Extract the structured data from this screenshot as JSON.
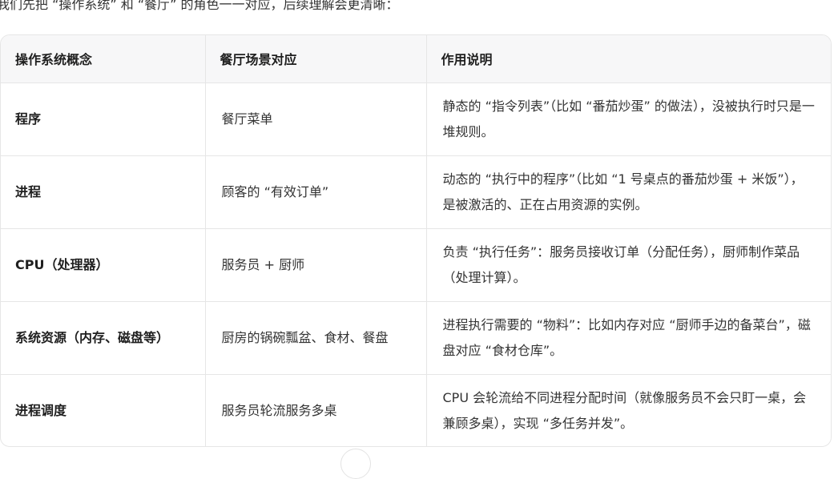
{
  "intro": "我们先把 “操作系统” 和 “餐厅” 的角色一一对应，后续理解会更清晰：",
  "table": {
    "headers": [
      "操作系统概念",
      "餐厅场景对应",
      "作用说明"
    ],
    "rows": [
      {
        "concept": "程序",
        "scene": "餐厅菜单",
        "desc": "静态的 “指令列表”（比如 “番茄炒蛋” 的做法），没被执行时只是一堆规则。"
      },
      {
        "concept": "进程",
        "scene": "顾客的 “有效订单”",
        "desc": "动态的 “执行中的程序”（比如 “1 号桌点的番茄炒蛋 + 米饭”），是被激活的、正在占用资源的实例。"
      },
      {
        "concept": "CPU（处理器）",
        "scene": "服务员 + 厨师",
        "desc": "负责 “执行任务”：服务员接收订单（分配任务），厨师制作菜品（处理计算）。"
      },
      {
        "concept": "系统资源（内存、磁盘等）",
        "scene": "厨房的锅碗瓢盆、食材、餐盘",
        "desc": "进程执行需要的 “物料”：比如内存对应 “厨师手边的备菜台”，磁盘对应 “食材仓库”。"
      },
      {
        "concept": "进程调度",
        "scene": "服务员轮流服务多桌",
        "desc": "CPU 会轮流给不同进程分配时间（就像服务员不会只盯一桌，会兼顾多桌），实现 “多任务并发”。"
      }
    ]
  }
}
